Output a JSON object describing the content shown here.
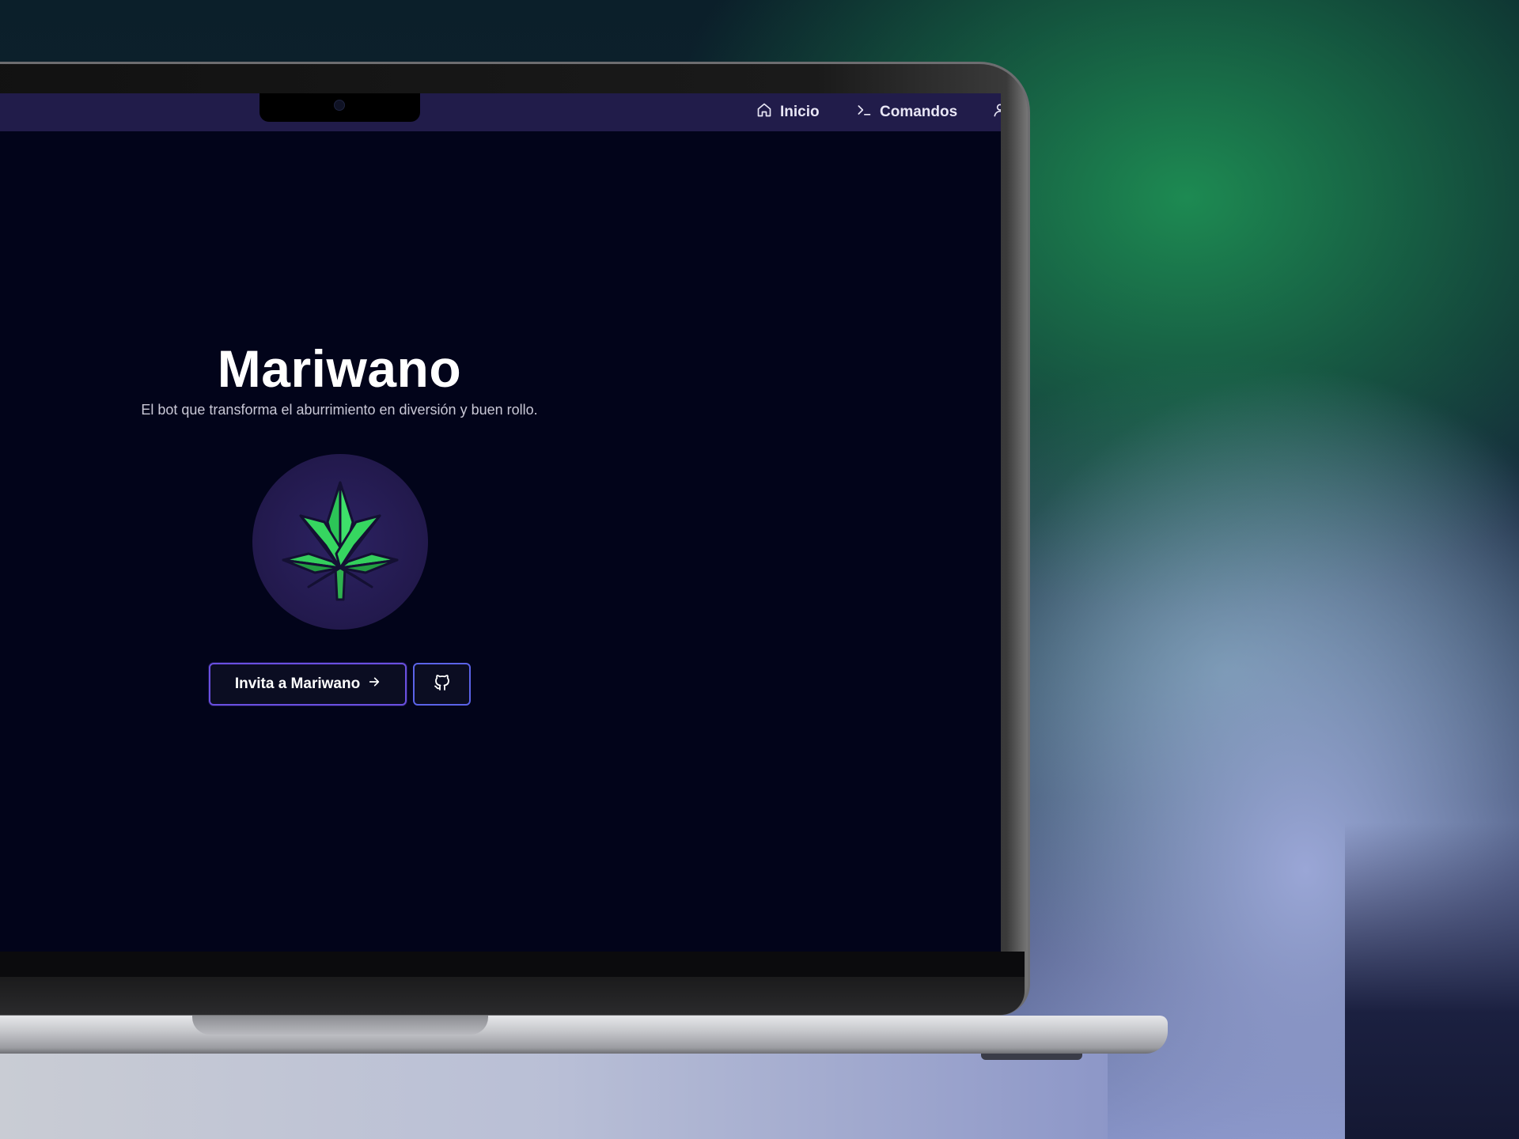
{
  "navbar": {
    "items": [
      {
        "label": "Inicio",
        "icon": "home-icon"
      },
      {
        "label": "Comandos",
        "icon": "terminal-icon"
      }
    ],
    "background": "#211c4a"
  },
  "hero": {
    "title": "Mariwano",
    "subtitle": "El bot que transforma el aburrimiento en diversión y buen rollo.",
    "logo_icon": "cannabis-leaf-icon"
  },
  "actions": {
    "invite_label": "Invita a Mariwano",
    "invite_icon": "arrow-right-icon",
    "github_icon": "github-icon"
  },
  "colors": {
    "screen_bg": "#02041a",
    "accent_purple": "#6a4fe0",
    "accent_blue": "#5b63e8",
    "leaf_green": "#33d65c"
  }
}
